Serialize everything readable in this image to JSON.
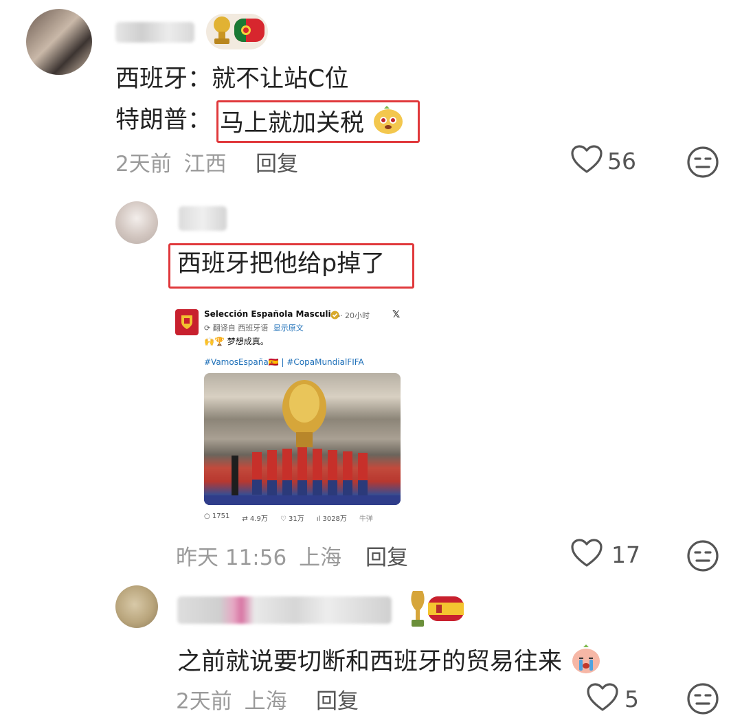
{
  "comments": [
    {
      "line1_prefix": "西班牙：",
      "line1_text": "就不让站C位",
      "line2_prefix": "特朗普：",
      "line2_highlight": "马上就加关税",
      "time": "2天前",
      "location": "江西",
      "reply_label": "回复",
      "likes": "56"
    },
    {
      "text": "西班牙把他给p掉了",
      "tweet": {
        "author": "Selección Española Masculi...",
        "time": "· 20小时",
        "translate": "翻译自 西班牙语",
        "show_original": "显示原文",
        "body": "梦想成真。",
        "hashtags": "#VamosEspaña🇪🇸 | #CopaMundialFIFA",
        "stats": {
          "replies": "1751",
          "retweets": "4.9万",
          "likes": "31万",
          "views": "3028万",
          "watermark": "牛弹"
        }
      },
      "time": "昨天 11:56",
      "location": "上海",
      "reply_label": "回复",
      "likes": "17"
    },
    {
      "text": "之前就说要切断和西班牙的贸易往来",
      "time": "2天前",
      "location": "上海",
      "reply_label": "回复",
      "likes": "5"
    }
  ],
  "icons": {
    "heart": "heart-icon",
    "dislike": "meh-face-icon",
    "trophy_badge": "trophy-icon",
    "portugal_flag": "portugal-flag-icon",
    "spain_flag": "spain-flag-icon",
    "x_logo": "x-logo-icon"
  },
  "colors": {
    "highlight_border": "#e0383b",
    "meta_gray": "#9a9a9a",
    "link_blue": "#1d6fb8"
  }
}
